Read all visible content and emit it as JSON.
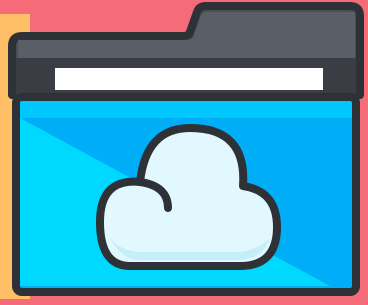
{
  "icon": {
    "name": "cloud-folder-icon"
  },
  "colors": {
    "background_pink": "#F56B78",
    "background_orange": "#FFBF66",
    "outline": "#2E3136",
    "folder_back": "#4A4F57",
    "folder_back_highlight": "#5A5F67",
    "folder_inner": "#3A3E44",
    "paper": "#FFFFFF",
    "front_light": "#00D9FF",
    "front_dark": "#00AEF7",
    "front_top": "#00C8FF",
    "cloud_fill": "#E1F9FE",
    "cloud_shadow": "#C4EEF8"
  }
}
